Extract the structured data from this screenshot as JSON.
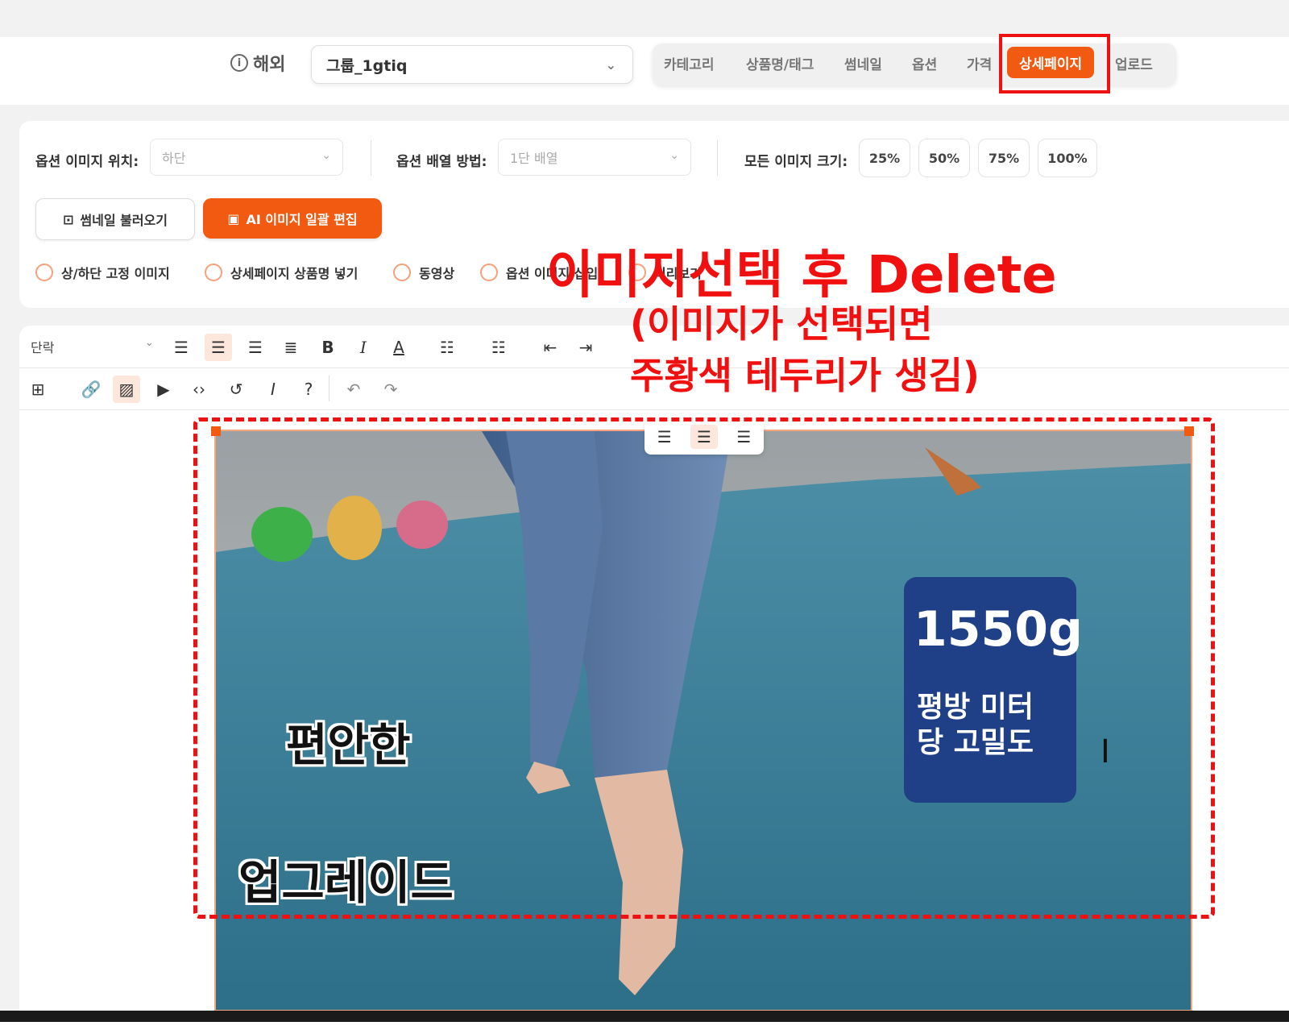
{
  "header": {
    "region_label": "해외",
    "group_value": "그룹_1gtiq",
    "tabs": [
      {
        "label": "카테고리"
      },
      {
        "label": "상품명/태그"
      },
      {
        "label": "썸네일"
      },
      {
        "label": "옵션"
      },
      {
        "label": "가격"
      },
      {
        "label": "상세페이지",
        "active": true
      },
      {
        "label": "업로드"
      }
    ]
  },
  "options": {
    "image_position_label": "옵션 이미지 위치:",
    "image_position_value": "하단",
    "layout_label": "옵션 배열 방법:",
    "layout_value": "1단 배열",
    "size_label": "모든 이미지 크기:",
    "sizes": [
      "25%",
      "50%",
      "75%",
      "100%"
    ],
    "load_thumbnail_label": "썸네일 불러오기",
    "ai_edit_label": "AI 이미지 일괄 편집",
    "checkboxes": [
      "상/하단 고정 이미지",
      "상세페이지 상품명 넣기",
      "동영상",
      "옵션 이미지 삽입",
      "미리보기"
    ]
  },
  "annotation": {
    "main": "이미지선택 후 Delete",
    "sub_line1": "(이미지가 선택되면",
    "sub_line2": "주황색 테두리가 생김)"
  },
  "editor": {
    "paragraph_label": "단락"
  },
  "image": {
    "text_comfortable": "편안한",
    "text_upgrade": "업그레이드",
    "badge_weight": "1550g",
    "badge_line1": "평방 미터",
    "badge_line2": "당 고밀도"
  },
  "colors": {
    "accent": "#f25a12",
    "annotation_red": "#f01010",
    "badge_blue": "#1f3f86",
    "carpet": "#2f7d98"
  },
  "icons": [
    "info-icon",
    "chevron-down-icon",
    "download-icon",
    "ai-edit-icon",
    "align-left-icon",
    "align-center-icon",
    "align-right-icon",
    "justify-icon",
    "bold-icon",
    "italic-icon",
    "text-color-icon",
    "bullet-list-icon",
    "numbered-list-icon",
    "outdent-icon",
    "indent-icon",
    "table-icon",
    "link-icon",
    "image-icon",
    "video-icon",
    "code-icon",
    "history-icon",
    "clear-format-icon",
    "help-icon",
    "undo-icon",
    "redo-icon",
    "text-cursor-icon"
  ]
}
